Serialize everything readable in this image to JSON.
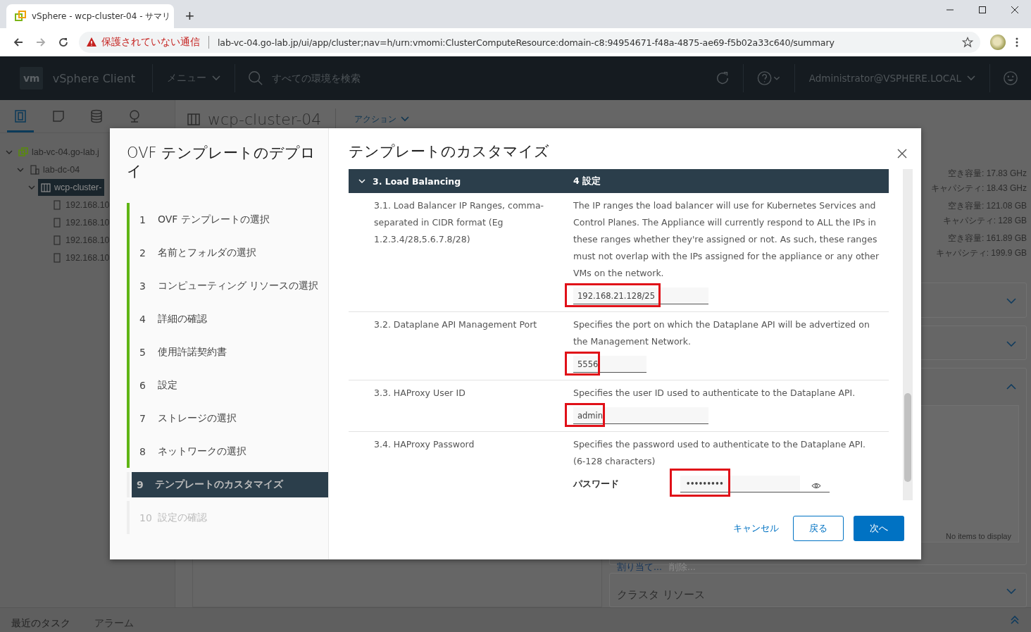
{
  "browser": {
    "tab_title": "vSphere - wcp-cluster-04 - サマリ",
    "new_tab": "+",
    "security": "保護されていない通信",
    "url": "lab-vc-04.go-lab.jp/ui/app/cluster;nav=h/urn:vmomi:ClusterComputeResource:domain-c8:94954671-f48a-4875-ae69-f5b02a33c640/summary"
  },
  "header": {
    "logo": "vm",
    "product": "vSphere Client",
    "menu": "メニュー",
    "search_placeholder": "すべての環境を検索",
    "user": "Administrator@VSPHERE.LOCAL"
  },
  "nav_tabs": [
    {
      "kind": "hosts",
      "selected": true
    },
    {
      "kind": "vms",
      "selected": false
    },
    {
      "kind": "storage",
      "selected": false
    },
    {
      "kind": "network",
      "selected": false
    }
  ],
  "tree": [
    {
      "label": "lab-vc-04.go-lab.j",
      "kind": "vcenter",
      "expanded": true,
      "selected": false,
      "children": [
        {
          "label": "lab-dc-04",
          "kind": "datacenter",
          "expanded": true,
          "selected": false,
          "children": [
            {
              "label": "wcp-cluster-",
              "kind": "cluster",
              "expanded": true,
              "selected": true,
              "children": [
                {
                  "label": "192.168.10",
                  "kind": "host",
                  "selected": false
                },
                {
                  "label": "192.168.10",
                  "kind": "host",
                  "selected": false
                },
                {
                  "label": "192.168.10",
                  "kind": "host",
                  "selected": false
                },
                {
                  "label": "192.168.10",
                  "kind": "host",
                  "selected": false
                }
              ]
            }
          ]
        }
      ]
    }
  ],
  "object": {
    "title": "wcp-cluster-04",
    "actions": "アクション"
  },
  "capacity": [
    "空き容量: 17.83 GHz",
    "キャパシティ: 18.43 GHz",
    "空き容量: 121.08 GB",
    "キャパシティ: 128 GB",
    "空き容量: 161.89 GB",
    "キャパシティ: 199.9 GB"
  ],
  "empty_list": "No items to display",
  "list_actions": [
    "割り当て...",
    "削除..."
  ],
  "cluster_resources": "クラスタ リソース",
  "bottom_tabs": [
    "最近のタスク",
    "アラーム"
  ],
  "wizard": {
    "title": "OVF テンプレートのデプロイ",
    "steps": [
      {
        "number": "1",
        "label": "OVF テンプレートの選択",
        "completed": true,
        "selected": false
      },
      {
        "number": "2",
        "label": "名前とフォルダの選択",
        "completed": true,
        "selected": false
      },
      {
        "number": "3",
        "label": "コンピューティング リソースの選択",
        "completed": true,
        "selected": false
      },
      {
        "number": "4",
        "label": "詳細の確認",
        "completed": true,
        "selected": false
      },
      {
        "number": "5",
        "label": "使用許諾契約書",
        "completed": true,
        "selected": false
      },
      {
        "number": "6",
        "label": "設定",
        "completed": true,
        "selected": false
      },
      {
        "number": "7",
        "label": "ストレージの選択",
        "completed": true,
        "selected": false
      },
      {
        "number": "8",
        "label": "ネットワークの選択",
        "completed": true,
        "selected": false
      },
      {
        "number": "9",
        "label": "テンプレートのカスタマイズ",
        "completed": false,
        "selected": true
      },
      {
        "number": "10",
        "label": "設定の確認",
        "completed": false,
        "selected": false
      }
    ],
    "heading": "テンプレートのカスタマイズ",
    "section": {
      "title": "3. Load Balancing",
      "count": "4 設定",
      "expanded": true
    },
    "settings": [
      {
        "kind": "text",
        "label": "3.1. Load Balancer IP Ranges, comma-separated in CIDR format (Eg 1.2.3.4/28,5.6.7.8/28)",
        "description": "The IP ranges the load balancer will use for Kubernetes Services and Control Planes. The Appliance will currently respond to ALL the IPs in these ranges whether they're assigned or not. As such, these ranges must not overlap with the IPs assigned for the appliance or any other VMs on the network.",
        "value": "192.168.21.128/25",
        "highlighted": true
      },
      {
        "kind": "port",
        "label": "3.2. Dataplane API Management Port",
        "description": "Specifies the port on which the Dataplane API will be advertized on the Management Network.",
        "value": "5556",
        "highlighted": true
      },
      {
        "kind": "text",
        "label": "3.3. HAProxy User ID",
        "description": "Specifies the user ID used to authenticate to the Dataplane API.",
        "value": "admin",
        "highlighted": true
      },
      {
        "kind": "password",
        "label": "3.4. HAProxy Password",
        "description": "Specifies the password used to authenticate to the Dataplane API. (6-128 characters)",
        "field_label": "パスワード",
        "value": "•••••••••",
        "highlighted": true
      }
    ],
    "buttons": {
      "cancel": "キャンセル",
      "back": "戻る",
      "next": "次へ"
    }
  }
}
